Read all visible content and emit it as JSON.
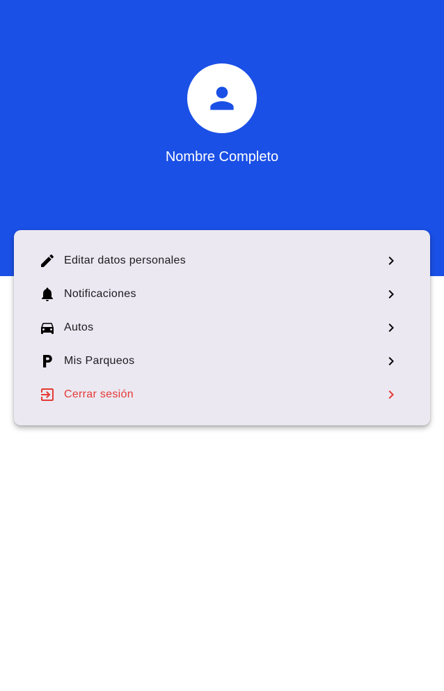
{
  "profile": {
    "name": "Nombre Completo",
    "avatar_icon": "person-icon"
  },
  "colors": {
    "header": "#1b50e6",
    "card": "#ebe8f1",
    "text": "#1c1b1f",
    "danger": "#e53935"
  },
  "menu": {
    "items": [
      {
        "label": "Editar datos personales",
        "icon": "edit-pencil-icon"
      },
      {
        "label": "Notificaciones",
        "icon": "bell-icon"
      },
      {
        "label": "Autos",
        "icon": "car-icon"
      },
      {
        "label": "Mis Parqueos",
        "icon": "parking-icon"
      },
      {
        "label": "Cerrar sesión",
        "icon": "logout-icon"
      }
    ]
  }
}
